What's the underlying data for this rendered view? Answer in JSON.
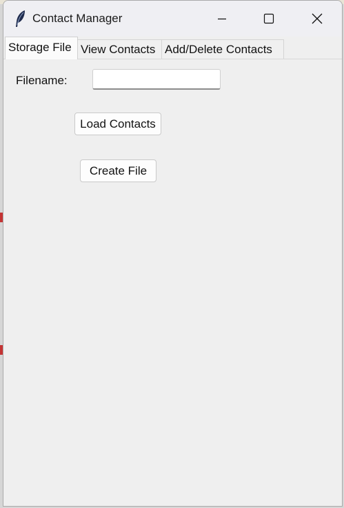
{
  "window": {
    "title": "Contact Manager",
    "icon": "feather-icon",
    "controls": {
      "minimize": "minimize-icon",
      "maximize": "maximize-icon",
      "close": "close-icon"
    }
  },
  "tabs": [
    {
      "label": "Storage File",
      "active": true
    },
    {
      "label": "View Contacts",
      "active": false
    },
    {
      "label": "Add/Delete Contacts",
      "active": false
    }
  ],
  "storage": {
    "filename_label": "Filename:",
    "filename_value": "",
    "load_button": "Load Contacts",
    "create_button": "Create File"
  },
  "colors": {
    "window_bg": "#efefef",
    "titlebar_bg": "#efeff3",
    "accent_marker": "#c43434"
  }
}
